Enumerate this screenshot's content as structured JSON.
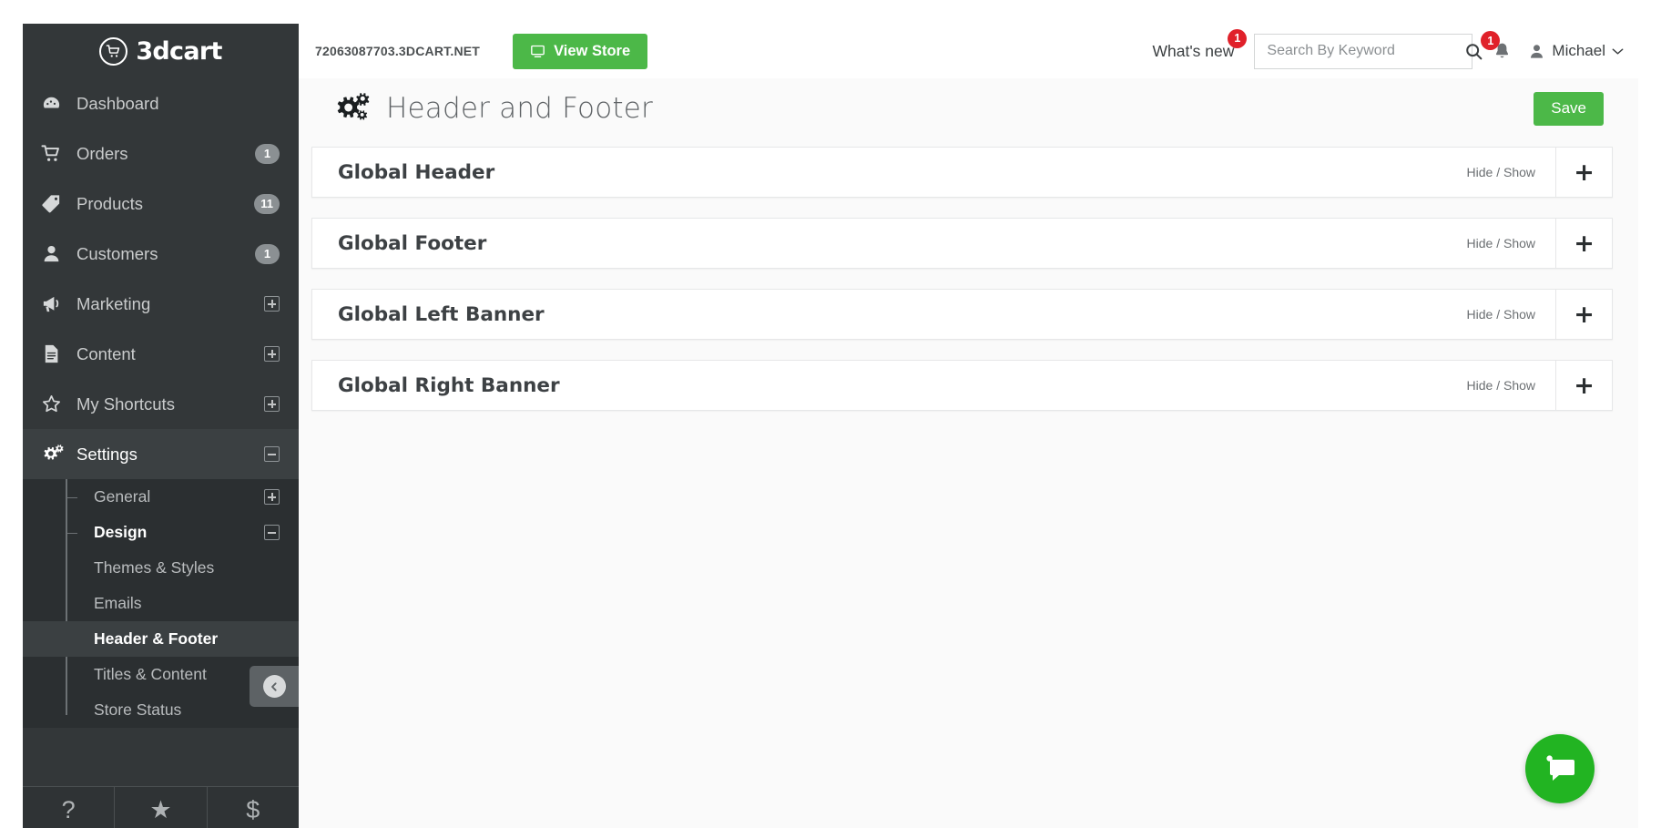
{
  "brand": {
    "name": "3dcart",
    "icon": "shopping-cart-icon"
  },
  "sidebar": {
    "items": [
      {
        "label": "Dashboard",
        "icon": "dashboard-icon",
        "badge": null,
        "expander": null
      },
      {
        "label": "Orders",
        "icon": "cart-icon",
        "badge": "1",
        "expander": null
      },
      {
        "label": "Products",
        "icon": "tag-icon",
        "badge": "11",
        "expander": null
      },
      {
        "label": "Customers",
        "icon": "user-icon",
        "badge": "1",
        "expander": null
      },
      {
        "label": "Marketing",
        "icon": "megaphone-icon",
        "badge": null,
        "expander": "plus"
      },
      {
        "label": "Content",
        "icon": "document-icon",
        "badge": null,
        "expander": "plus"
      },
      {
        "label": "My Shortcuts",
        "icon": "star-icon",
        "badge": null,
        "expander": "plus"
      },
      {
        "label": "Settings",
        "icon": "gears-icon",
        "badge": null,
        "expander": "minus"
      }
    ],
    "submenu": [
      {
        "label": "General",
        "expander": "plus",
        "style": "branch"
      },
      {
        "label": "Design",
        "expander": "minus",
        "style": "branch strong"
      },
      {
        "label": "Themes & Styles",
        "expander": null,
        "style": ""
      },
      {
        "label": "Emails",
        "expander": null,
        "style": ""
      },
      {
        "label": "Header & Footer",
        "expander": null,
        "style": "active"
      },
      {
        "label": "Titles & Content",
        "expander": null,
        "style": ""
      },
      {
        "label": "Store Status",
        "expander": null,
        "style": ""
      }
    ],
    "collapse_icon": "arrow-left-circle-icon",
    "bottom_tools": [
      {
        "icon": "help-question-icon",
        "glyph": "?"
      },
      {
        "icon": "star-icon",
        "glyph": "★"
      },
      {
        "icon": "dollar-icon",
        "glyph": "$"
      }
    ]
  },
  "topbar": {
    "store_domain": "72063087703.3DCART.NET",
    "view_store_label": "View Store",
    "view_store_icon": "monitor-icon",
    "whats_new_label": "What's new",
    "whats_new_badge": "1",
    "search_placeholder": "Search By Keyword",
    "search_value": "",
    "search_icon": "search-icon",
    "bell_icon": "bell-icon",
    "bell_badge": "1",
    "user_icon": "person-icon",
    "user_name": "Michael",
    "user_chevron": "chevron-down-icon"
  },
  "main": {
    "page_icon": "gears-icon",
    "page_title": "Header and Footer",
    "save_label": "Save",
    "panels": [
      {
        "title": "Global Header",
        "hide_show": "Hide / Show",
        "toggle": "+"
      },
      {
        "title": "Global Footer",
        "hide_show": "Hide / Show",
        "toggle": "+"
      },
      {
        "title": "Global Left Banner",
        "hide_show": "Hide / Show",
        "toggle": "+"
      },
      {
        "title": "Global Right Banner",
        "hide_show": "Hide / Show",
        "toggle": "+"
      }
    ],
    "chat_icon": "chat-bubble-icon"
  },
  "colors": {
    "sidebar_bg": "#333739",
    "submenu_bg": "#2b2f31",
    "accent_green": "#4cb848",
    "badge_red": "#e0212a",
    "chat_green": "#22b422"
  }
}
